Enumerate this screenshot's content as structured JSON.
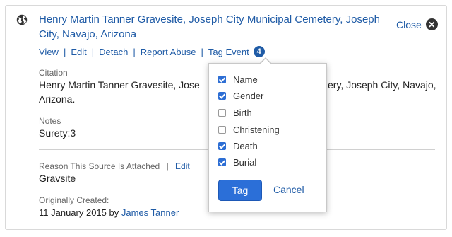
{
  "source": {
    "title": "Henry Martin Tanner Gravesite, Joseph City Municipal Cemetery, Joseph City, Navajo, Arizona",
    "close_label": "Close",
    "actions": {
      "view": "View",
      "edit": "Edit",
      "detach": "Detach",
      "report_abuse": "Report Abuse",
      "tag_event": "Tag Event",
      "tag_count": "4",
      "separator": "|"
    },
    "citation": {
      "label": "Citation",
      "value_line1": "Henry Martin Tanner Gravesite, Jose",
      "value_line1_end": "ery, Joseph City, Navajo,",
      "value_line2": "Arizona."
    },
    "notes": {
      "label": "Notes",
      "value": "Surety:3"
    },
    "reason": {
      "label": "Reason This Source Is Attached",
      "separator": "|",
      "edit": "Edit",
      "value": "Gravsite"
    },
    "created": {
      "label": "Originally Created:",
      "date": "11 January 2015",
      "by": "by",
      "author": "James Tanner"
    }
  },
  "tag_popup": {
    "options": [
      {
        "label": "Name",
        "checked": true
      },
      {
        "label": "Gender",
        "checked": true
      },
      {
        "label": "Birth",
        "checked": false
      },
      {
        "label": "Christening",
        "checked": false
      },
      {
        "label": "Death",
        "checked": true
      },
      {
        "label": "Burial",
        "checked": true
      }
    ],
    "tag_label": "Tag",
    "cancel_label": "Cancel"
  },
  "icons": {
    "globe": "globe-icon",
    "close": "close-icon",
    "checkbox": "checkbox-icon"
  },
  "colors": {
    "link": "#1f5ba6",
    "primary_button": "#2b6fd8",
    "checkbox_checked": "#2d6ed4"
  }
}
